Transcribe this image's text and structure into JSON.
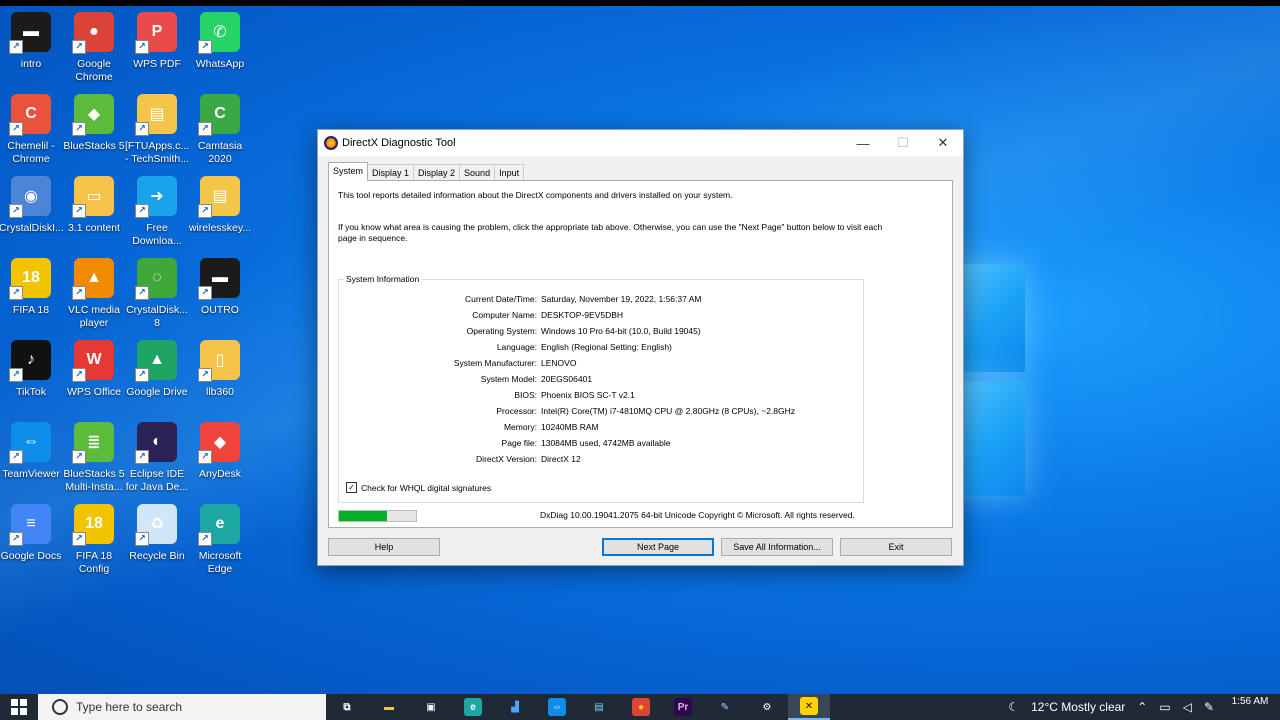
{
  "desktop": {
    "icons": [
      {
        "label": "intro",
        "icon": "video-file-icon",
        "color": "#1b1b1b",
        "glyph": "▬"
      },
      {
        "label": "Google Chrome",
        "icon": "chrome-icon",
        "color": "#db4437",
        "glyph": "●"
      },
      {
        "label": "WPS PDF",
        "icon": "wps-pdf-icon",
        "color": "#e94a4a",
        "glyph": "P"
      },
      {
        "label": "WhatsApp",
        "icon": "whatsapp-icon",
        "color": "#25d366",
        "glyph": "✆"
      },
      {
        "label": "Chemelil - Chrome",
        "icon": "chrome-profile-icon",
        "color": "#e8543b",
        "glyph": "C"
      },
      {
        "label": "BlueStacks 5",
        "icon": "bluestacks-icon",
        "color": "#5dbb3c",
        "glyph": "◆"
      },
      {
        "label": "[FTUApps.c... - TechSmith...",
        "icon": "folder-zip-icon",
        "color": "#f3c64b",
        "glyph": "▤"
      },
      {
        "label": "Camtasia 2020",
        "icon": "camtasia-icon",
        "color": "#3aa843",
        "glyph": "C"
      },
      {
        "label": "CrystalDiskI...",
        "icon": "crystaldiskinfo-icon",
        "color": "#4c84d6",
        "glyph": "◉"
      },
      {
        "label": "3.1 content",
        "icon": "folder-icon",
        "color": "#f5c24a",
        "glyph": "▭"
      },
      {
        "label": "Free Downloa...",
        "icon": "download-manager-icon",
        "color": "#1aa3e8",
        "glyph": "➜"
      },
      {
        "label": "wirelesskey...",
        "icon": "folder-zip-icon",
        "color": "#f3c64b",
        "glyph": "▤"
      },
      {
        "label": "FIFA 18",
        "icon": "fifa-icon",
        "color": "#f2c400",
        "glyph": "18"
      },
      {
        "label": "VLC media player",
        "icon": "vlc-icon",
        "color": "#f08a00",
        "glyph": "▲"
      },
      {
        "label": "CrystalDisk... 8",
        "icon": "crystaldiskmark-icon",
        "color": "#3fa83a",
        "glyph": "◌"
      },
      {
        "label": "OUTRO",
        "icon": "video-file-icon",
        "color": "#1b1b1b",
        "glyph": "▬"
      },
      {
        "label": "TikTok",
        "icon": "tiktok-icon",
        "color": "#111111",
        "glyph": "♪"
      },
      {
        "label": "WPS Office",
        "icon": "wps-office-icon",
        "color": "#e53935",
        "glyph": "W"
      },
      {
        "label": "Google Drive",
        "icon": "google-drive-icon",
        "color": "#1fa463",
        "glyph": "▲"
      },
      {
        "label": "llb360",
        "icon": "document-icon",
        "color": "#f5c24a",
        "glyph": "▯"
      },
      {
        "label": "TeamViewer",
        "icon": "teamviewer-icon",
        "color": "#0e8ee9",
        "glyph": "⇔"
      },
      {
        "label": "BlueStacks 5 Multi-Insta...",
        "icon": "bluestacks-multi-icon",
        "color": "#5dbb3c",
        "glyph": "≣"
      },
      {
        "label": "Eclipse IDE for Java De...",
        "icon": "eclipse-icon",
        "color": "#2c2255",
        "glyph": "◐"
      },
      {
        "label": "AnyDesk",
        "icon": "anydesk-icon",
        "color": "#ef443b",
        "glyph": "◆"
      },
      {
        "label": "Google Docs",
        "icon": "google-docs-icon",
        "color": "#4285f4",
        "glyph": "≡"
      },
      {
        "label": "FIFA 18 Config",
        "icon": "fifa-config-icon",
        "color": "#f2c400",
        "glyph": "18"
      },
      {
        "label": "Recycle Bin",
        "icon": "recycle-bin-icon",
        "color": "#cfe7f7",
        "glyph": "♻"
      },
      {
        "label": "Microsoft Edge",
        "icon": "edge-icon",
        "color": "#1ca7a3",
        "glyph": "e"
      }
    ]
  },
  "dialog": {
    "title": "DirectX Diagnostic Tool",
    "controls": {
      "minimize": "—",
      "maximize": "☐",
      "close": "✕"
    },
    "tabs": [
      "System",
      "Display 1",
      "Display 2",
      "Sound",
      "Input"
    ],
    "intro_1": "This tool reports detailed information about the DirectX components and drivers installed on your system.",
    "intro_2": "If you know what area is causing the problem, click the appropriate tab above.  Otherwise, you can use the \"Next Page\" button below to visit each page in sequence.",
    "system_info_title": "System Information",
    "system_info": [
      {
        "key": "Current Date/Time:",
        "value": "Saturday, November 19, 2022, 1:56:37 AM"
      },
      {
        "key": "Computer Name:",
        "value": "DESKTOP-9EV5DBH"
      },
      {
        "key": "Operating System:",
        "value": "Windows 10 Pro 64-bit (10.0, Build 19045)"
      },
      {
        "key": "Language:",
        "value": "English (Regional Setting: English)"
      },
      {
        "key": "System Manufacturer:",
        "value": "LENOVO"
      },
      {
        "key": "System Model:",
        "value": "20EGS06401"
      },
      {
        "key": "BIOS:",
        "value": "Phoenix BIOS SC-T v2.1"
      },
      {
        "key": "Processor:",
        "value": "Intel(R) Core(TM) i7-4810MQ CPU @ 2.80GHz (8 CPUs), ~2.8GHz"
      },
      {
        "key": "Memory:",
        "value": "10240MB RAM"
      },
      {
        "key": "Page file:",
        "value": "13084MB used, 4742MB available"
      },
      {
        "key": "DirectX Version:",
        "value": "DirectX 12"
      }
    ],
    "whql_label": "Check for WHQL digital signatures",
    "whql_checked": "✓",
    "progress_fraction": 0.62,
    "footer": "DxDiag 10.00.19041.2075 64-bit Unicode  Copyright © Microsoft. All rights reserved.",
    "buttons": {
      "help": "Help",
      "next_page": "Next Page",
      "save_all": "Save All Information...",
      "exit": "Exit"
    }
  },
  "taskbar": {
    "search_placeholder": "Type here to search",
    "apps": [
      {
        "name": "task-view-icon",
        "glyph": "⧉",
        "color": "#ffffff",
        "bg": "transparent"
      },
      {
        "name": "file-explorer-icon",
        "glyph": "▬",
        "color": "#f5c24a",
        "bg": "transparent"
      },
      {
        "name": "store-icon",
        "glyph": "▣",
        "color": "#ffffff",
        "bg": "transparent"
      },
      {
        "name": "edge-icon",
        "glyph": "e",
        "color": "#ffffff",
        "bg": "#1ca7a3"
      },
      {
        "name": "network-monitor-icon",
        "glyph": "▟",
        "color": "#4fa3ff",
        "bg": "transparent"
      },
      {
        "name": "teamviewer-icon",
        "glyph": "⇔",
        "color": "#ffffff",
        "bg": "#0e8ee9"
      },
      {
        "name": "notepad-icon",
        "glyph": "▤",
        "color": "#7fd0ff",
        "bg": "transparent"
      },
      {
        "name": "chrome-icon",
        "glyph": "●",
        "color": "#ffcc00",
        "bg": "#db4437"
      },
      {
        "name": "premiere-icon",
        "glyph": "Pr",
        "color": "#e8a8ff",
        "bg": "#2a0a4a"
      },
      {
        "name": "pen-app-icon",
        "glyph": "✎",
        "color": "#9fd4ff",
        "bg": "transparent"
      },
      {
        "name": "settings-icon",
        "glyph": "⚙",
        "color": "#ffffff",
        "bg": "transparent"
      },
      {
        "name": "directx-icon",
        "glyph": "✕",
        "color": "#1b1b1b",
        "bg": "#ffd200"
      }
    ],
    "weather": "12°C  Mostly clear",
    "time": "1:56 AM"
  }
}
